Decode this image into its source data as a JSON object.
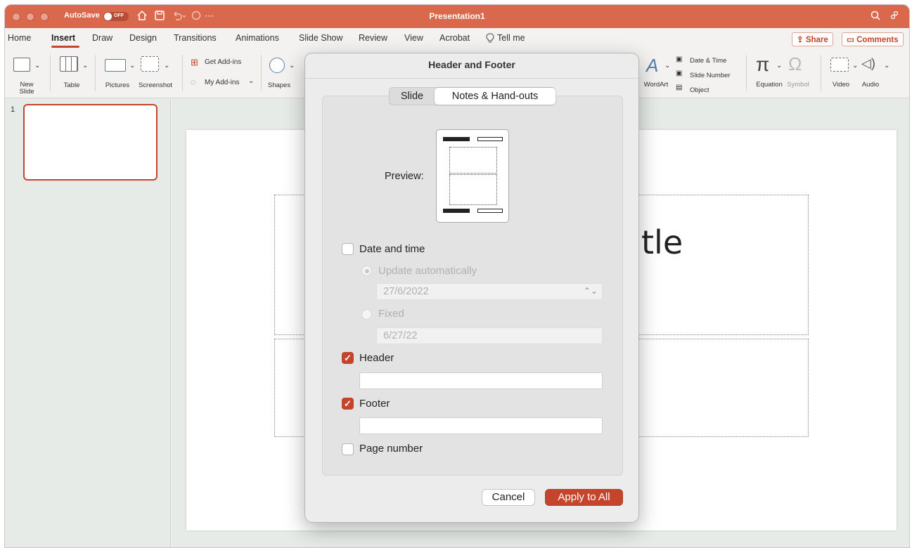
{
  "titlebar": {
    "autosave_label": "AutoSave",
    "autosave_state": "OFF",
    "doc_title": "Presentation1",
    "quick_icons": [
      "home-icon",
      "save-icon",
      "undo-icon",
      "redo-icon",
      "more-icon"
    ],
    "right_icons": [
      "search-icon",
      "share-people-icon"
    ]
  },
  "menu": {
    "tabs": [
      "Home",
      "Insert",
      "Draw",
      "Design",
      "Transitions",
      "Animations",
      "Slide Show",
      "Review",
      "View",
      "Acrobat"
    ],
    "tell_me": "Tell me",
    "active_tab": "Insert",
    "share_label": "Share",
    "comments_label": "Comments"
  },
  "ribbon": {
    "new_slide": "New\nSlide",
    "table": "Table",
    "pictures": "Pictures",
    "screenshot": "Screenshot",
    "get_addins": "Get Add-ins",
    "my_addins": "My Add-ins",
    "shapes": "Shapes",
    "wordart": "WordArt",
    "date_time": "Date & Time",
    "slide_number": "Slide Number",
    "object": "Object",
    "equation": "Equation",
    "symbol": "Symbol",
    "video": "Video",
    "audio": "Audio"
  },
  "thumbnails": {
    "slide_number": "1"
  },
  "slide": {
    "title_fragment": "tle"
  },
  "dialog": {
    "title": "Header and Footer",
    "tabs": [
      "Slide",
      "Notes & Hand-outs"
    ],
    "selected_tab": "Notes & Hand-outs",
    "preview_label": "Preview:",
    "date_time": {
      "label": "Date and time",
      "checked": false
    },
    "update_auto": {
      "label": "Update automatically",
      "selected": true,
      "enabled": false
    },
    "date_select_value": "27/6/2022",
    "fixed": {
      "label": "Fixed",
      "selected": false,
      "enabled": false
    },
    "fixed_value": "6/27/22",
    "header": {
      "label": "Header",
      "checked": true,
      "value": ""
    },
    "footer": {
      "label": "Footer",
      "checked": true,
      "value": ""
    },
    "page_number": {
      "label": "Page number",
      "checked": false
    },
    "cancel_label": "Cancel",
    "apply_label": "Apply to All"
  },
  "colors": {
    "accent": "#c4452b",
    "titlebar": "#d9684d",
    "pane": "#e6ebe7"
  }
}
